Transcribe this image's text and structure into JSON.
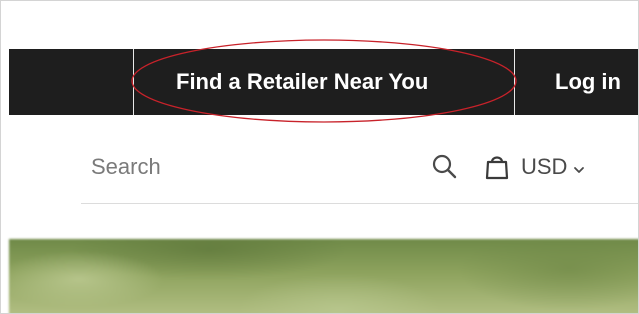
{
  "topbar": {
    "retailer_link": "Find a Retailer Near You",
    "login_link": "Log in"
  },
  "search": {
    "placeholder": "Search",
    "value": ""
  },
  "header": {
    "currency": "USD"
  },
  "icons": {
    "search": "search-icon",
    "cart": "shopping-bag-icon",
    "currency_dropdown": "chevron-down-icon"
  },
  "colors": {
    "topbar_bg": "#1e1e1e",
    "annotation": "#c8222a"
  }
}
